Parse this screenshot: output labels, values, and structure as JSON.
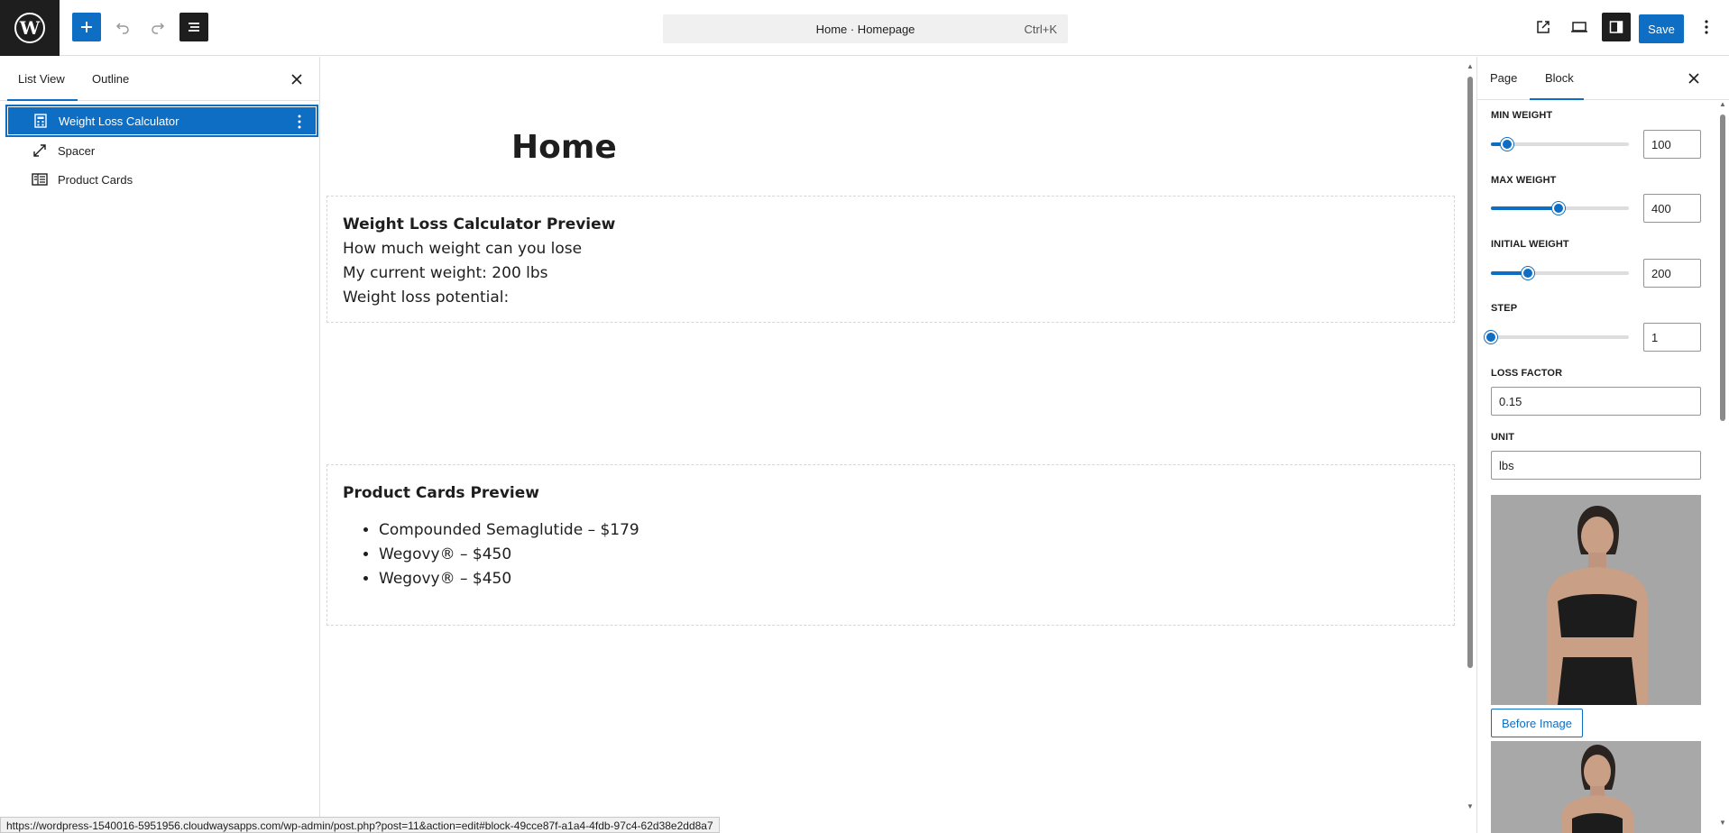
{
  "topbar": {
    "command_title": "Home · Homepage",
    "command_shortcut": "Ctrl+K",
    "save_label": "Save"
  },
  "left_panel": {
    "tabs": [
      {
        "label": "List View"
      },
      {
        "label": "Outline"
      }
    ],
    "items": [
      {
        "label": "Weight Loss Calculator",
        "icon": "calculator-icon",
        "selected": true
      },
      {
        "label": "Spacer",
        "icon": "resize-icon"
      },
      {
        "label": "Product Cards",
        "icon": "columns-icon"
      }
    ]
  },
  "canvas": {
    "page_title": "Home",
    "calculator_preview": {
      "title": "Weight Loss Calculator Preview",
      "lines": [
        "How much weight can you lose",
        "My current weight: 200 lbs",
        "Weight loss potential:"
      ]
    },
    "products_preview": {
      "title": "Product Cards Preview",
      "items": [
        "Compounded Semaglutide – $179",
        "Wegovy® – $450",
        "Wegovy® – $450"
      ]
    }
  },
  "right_panel": {
    "tabs": [
      {
        "label": "Page"
      },
      {
        "label": "Block"
      }
    ],
    "controls": {
      "min_weight": {
        "label": "MIN WEIGHT",
        "value": "100",
        "fraction": 0.12
      },
      "max_weight": {
        "label": "MAX WEIGHT",
        "value": "400",
        "fraction": 0.49
      },
      "initial_weight": {
        "label": "INITIAL WEIGHT",
        "value": "200",
        "fraction": 0.27
      },
      "step": {
        "label": "STEP",
        "value": "1",
        "fraction": 0.0
      },
      "loss_factor": {
        "label": "LOSS FACTOR",
        "value": "0.15"
      },
      "unit": {
        "label": "UNIT",
        "value": "lbs"
      }
    },
    "before_image_label": "Before Image"
  },
  "status_url": "https://wordpress-1540016-5951956.cloudwaysapps.com/wp-admin/post.php?post=11&action=edit#block-49cce87f-a1a4-4fdb-97c4-62d38e2dd8a7",
  "colors": {
    "accent": "#0e6ec4",
    "dark": "#1e1e1e"
  }
}
